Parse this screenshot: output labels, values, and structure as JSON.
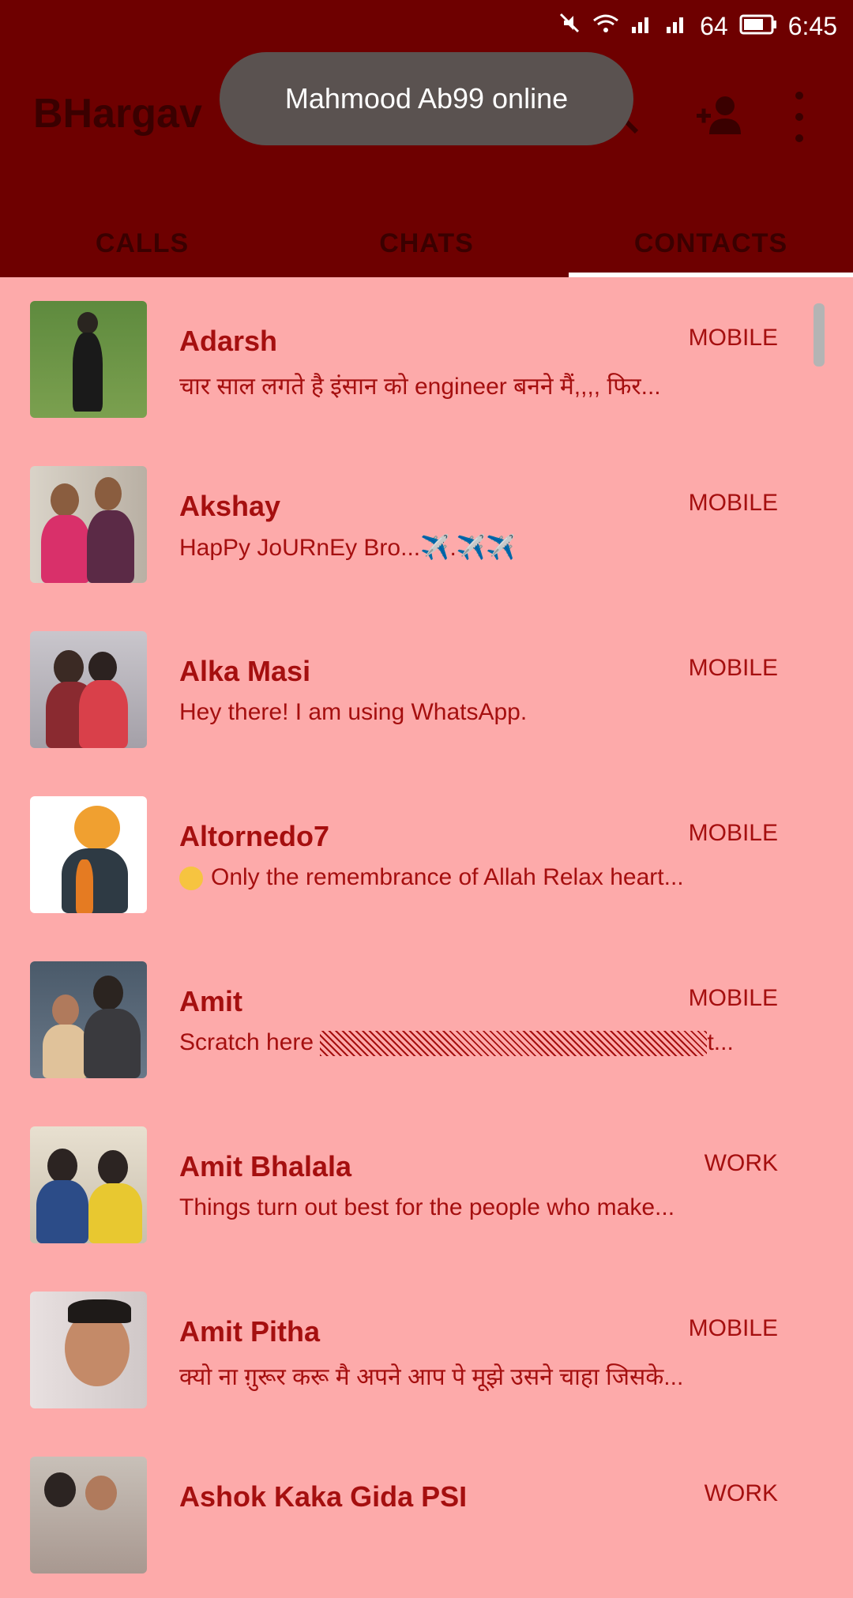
{
  "status_bar": {
    "battery": "64",
    "time": "6:45"
  },
  "app": {
    "title": "BHargav"
  },
  "toast": {
    "text": "Mahmood Ab99 online"
  },
  "tabs": [
    "CALLS",
    "CHATS",
    "CONTACTS"
  ],
  "contacts": [
    {
      "name": "Adarsh",
      "type": "MOBILE",
      "status": "चार साल लगते है इंसान को engineer बनने मैं,,,, फिर..."
    },
    {
      "name": "Akshay",
      "type": "MOBILE",
      "status": "HapPy JoURnEy Bro...✈️.✈️✈️"
    },
    {
      "name": "Alka Masi",
      "type": "MOBILE",
      "status": "Hey there! I am using WhatsApp."
    },
    {
      "name": "Altornedo7",
      "type": "MOBILE",
      "status": "Only the remembrance of Allah Relax heart..."
    },
    {
      "name": "Amit",
      "type": "MOBILE",
      "status_prefix": "Scratch here",
      "status_suffix": "t..."
    },
    {
      "name": "Amit Bhalala",
      "type": "WORK",
      "status": "Things turn out best for the people who make..."
    },
    {
      "name": "Amit Pitha",
      "type": "MOBILE",
      "status": "क्यो ना ग़ुरूर करू मै अपने आप पे मूझे उसने चाहा जिसके..."
    },
    {
      "name": "Ashok Kaka Gida PSI",
      "type": "WORK",
      "status": ""
    }
  ]
}
